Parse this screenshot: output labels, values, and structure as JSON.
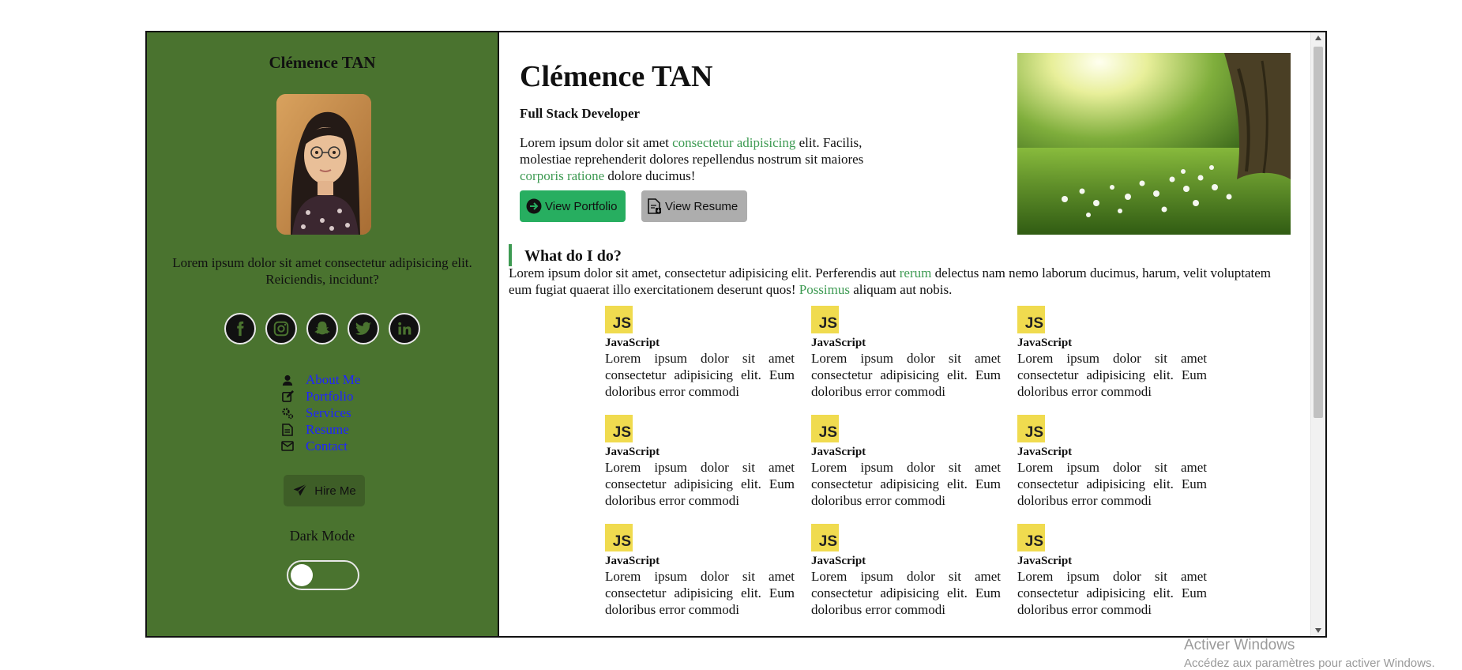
{
  "sidebar": {
    "name": "Clémence TAN",
    "description": "Lorem ipsum dolor sit amet consectetur adipisicing elit. Reiciendis, incidunt?",
    "socials": [
      "facebook-icon",
      "instagram-icon",
      "snapchat-icon",
      "twitter-icon",
      "linkedin-icon"
    ],
    "nav": [
      {
        "icon": "user-icon",
        "label": "About Me"
      },
      {
        "icon": "edit-icon",
        "label": "Portfolio"
      },
      {
        "icon": "gears-icon",
        "label": "Services"
      },
      {
        "icon": "file-icon",
        "label": "Resume"
      },
      {
        "icon": "mail-icon",
        "label": "Contact"
      }
    ],
    "hire_label": "Hire Me",
    "dark_mode_label": "Dark Mode",
    "dark_mode_on": false,
    "bg_color": "#4a732f"
  },
  "header": {
    "name": "Clémence TAN",
    "role": "Full Stack Developer",
    "intro_parts": [
      "Lorem ipsum dolor sit amet ",
      "consectetur adipisicing",
      " elit. Facilis, molestiae reprehenderit dolores repellendus nostrum sit maiores ",
      "corporis ratione",
      " dolore ducimus!"
    ],
    "portfolio_btn": "View Portfolio",
    "resume_btn": "View Resume"
  },
  "services": {
    "title": "What do I do?",
    "desc_parts": [
      "Lorem ipsum dolor sit amet, consectetur adipisicing elit. Perferendis aut ",
      "rerum",
      " delectus nam nemo laborum ducimus, harum, velit voluptatem eum fugiat quaerat illo exercitationem deserunt quos! ",
      "Possimus",
      " aliquam aut nobis."
    ],
    "badge_text": "JS",
    "cards": [
      {
        "title": "JavaScript",
        "text": "Lorem ipsum dolor sit amet consectetur adipisicing elit. Eum doloribus error commodi"
      },
      {
        "title": "JavaScript",
        "text": "Lorem ipsum dolor sit amet consectetur adipisicing elit. Eum doloribus error commodi"
      },
      {
        "title": "JavaScript",
        "text": "Lorem ipsum dolor sit amet consectetur adipisicing elit. Eum doloribus error commodi"
      },
      {
        "title": "JavaScript",
        "text": "Lorem ipsum dolor sit amet consectetur adipisicing elit. Eum doloribus error commodi"
      },
      {
        "title": "JavaScript",
        "text": "Lorem ipsum dolor sit amet consectetur adipisicing elit. Eum doloribus error commodi"
      },
      {
        "title": "JavaScript",
        "text": "Lorem ipsum dolor sit amet consectetur adipisicing elit. Eum doloribus error commodi"
      },
      {
        "title": "JavaScript",
        "text": "Lorem ipsum dolor sit amet consectetur adipisicing elit. Eum doloribus error commodi"
      },
      {
        "title": "JavaScript",
        "text": "Lorem ipsum dolor sit amet consectetur adipisicing elit. Eum doloribus error commodi"
      },
      {
        "title": "JavaScript",
        "text": "Lorem ipsum dolor sit amet consectetur adipisicing elit. Eum doloribus error commodi"
      }
    ]
  },
  "watermark": {
    "line1": "Activer Windows",
    "line2": "Accédez aux paramètres pour activer Windows."
  },
  "colors": {
    "accent": "#3d9a52",
    "primary_button": "#27ae60",
    "secondary_button": "#adadad",
    "link": "#1f24ff"
  }
}
